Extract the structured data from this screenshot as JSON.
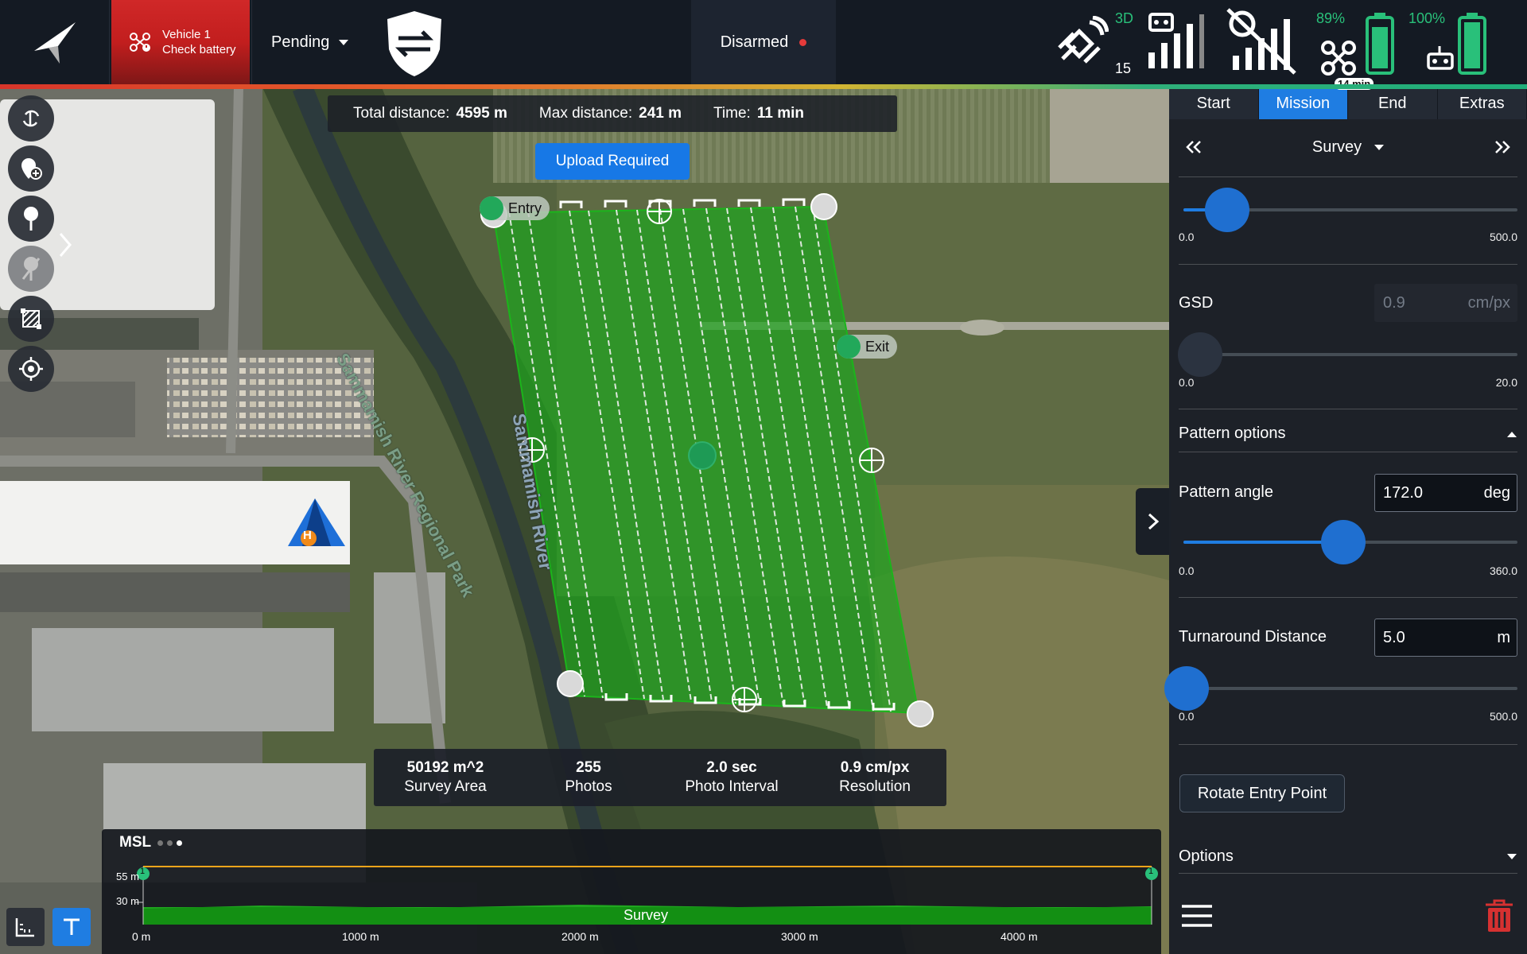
{
  "topbar": {
    "vehicle": {
      "line1": "Vehicle 1",
      "line2": "Check battery"
    },
    "flight_mode": "Pending",
    "arm_status": "Disarmed",
    "gps": {
      "fix": "3D",
      "satellites": "15"
    },
    "drone_battery": "89%",
    "flight_time": "14 min",
    "rc_battery": "100%",
    "colors": {
      "alert": "#c21e1e",
      "ok": "#29c07a",
      "accent": "#1f7de2"
    }
  },
  "left_tools": [
    {
      "icon": "sync-icon"
    },
    {
      "icon": "add-waypoint-icon"
    },
    {
      "icon": "pin-icon"
    },
    {
      "icon": "pin-disabled-icon"
    },
    {
      "icon": "survey-pattern-icon"
    },
    {
      "icon": "center-target-icon"
    }
  ],
  "map": {
    "stats": {
      "total_distance_label": "Total distance:",
      "total_distance": "4595 m",
      "max_distance_label": "Max distance:",
      "max_distance": "241 m",
      "time_label": "Time:",
      "time": "11 min"
    },
    "upload_button": "Upload Required",
    "entry_label": "Entry",
    "exit_label": "Exit",
    "home_label": "H",
    "place_labels": [
      "Sammamish River Regional Park",
      "Sammamish River"
    ],
    "survey_stats": [
      {
        "value": "50192 m^2",
        "label": "Survey Area"
      },
      {
        "value": "255",
        "label": "Photos"
      },
      {
        "value": "2.0 sec",
        "label": "Photo Interval"
      },
      {
        "value": "0.9 cm/px",
        "label": "Resolution"
      }
    ]
  },
  "profile": {
    "title": "MSL",
    "y_ticks": [
      "55 m",
      "30 m"
    ],
    "x_ticks": [
      "0 m",
      "1000 m",
      "2000 m",
      "3000 m",
      "4000 m"
    ],
    "segment_label": "Survey",
    "start_marker": "1",
    "end_marker": "1"
  },
  "panel": {
    "tabs": [
      "Start",
      "Mission",
      "End",
      "Extras"
    ],
    "active_tab": "Mission",
    "item_select": "Survey",
    "slider1": {
      "min": "0.0",
      "max": "500.0",
      "value": 0.13
    },
    "gsd": {
      "label": "GSD",
      "value": "0.9",
      "unit": "cm/px",
      "min": "0.0",
      "max": "20.0",
      "slider": 0.05
    },
    "pattern_options_label": "Pattern options",
    "pattern_angle": {
      "label": "Pattern angle",
      "value": "172.0",
      "unit": "deg",
      "min": "0.0",
      "max": "360.0",
      "slider": 0.478
    },
    "turnaround": {
      "label": "Turnaround Distance",
      "value": "5.0",
      "unit": "m",
      "min": "0.0",
      "max": "500.0",
      "slider": 0.01
    },
    "rotate_button": "Rotate Entry Point",
    "options_label": "Options"
  }
}
